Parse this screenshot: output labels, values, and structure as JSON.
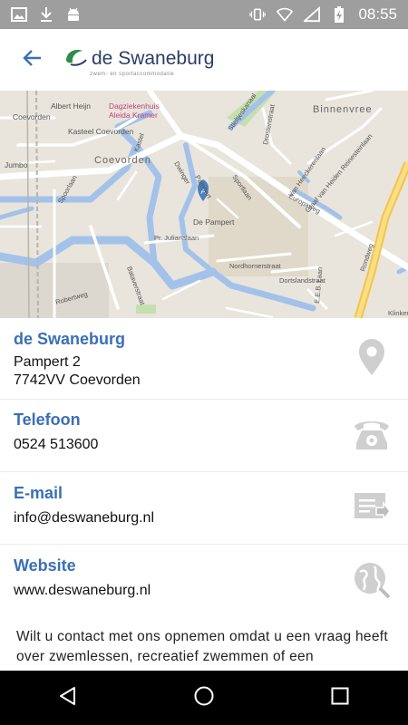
{
  "status_bar": {
    "time": "08:55",
    "icons": [
      "image-icon",
      "download-icon",
      "android-icon",
      "vibrate-icon",
      "wifi-icon",
      "signal-icon",
      "battery-charging-icon"
    ]
  },
  "header": {
    "logo_text": "de Swaneburg",
    "logo_subtitle": "zwem- en sportaccommodatie"
  },
  "map": {
    "labels": {
      "albert_heijn": "Albert Heijn",
      "dagziekenhuis": "Dagziekenhuis",
      "aleida": "Aleida Kramer",
      "coevorden_small": "Coevorden",
      "kasteel": "Kasteel Coevorden",
      "coevorden": "Coevorden",
      "binnenvree": "Binnenvree",
      "jumbo": "Jumbo",
      "de_pampert": "De Pampert",
      "pampert": "Pampert",
      "sportlaan": "Sportlaan",
      "europaweg": "Europaweg",
      "julianalaan": "Pr. Julianalaan",
      "bataverstraat": "Bataverstraat",
      "nordhornerstraat": "Nordhornerstraat",
      "dortslandstraat": "Dortslandstraat",
      "eeblaan": "E.E.B. Laan",
      "klinker": "Klinker",
      "rondweg": "Rondweg",
      "stieltjeskanaal": "Stieltjeskanaal",
      "drostenstraat": "Drostenstraat",
      "kastel": "Kastel",
      "dwinger": "Dwinger",
      "spoorlaan": "Spoorlaan",
      "robertweg": "Robertweg",
      "van_heeckerenlaan": "Van Heeckerenlaan",
      "graaf": "Graaf van Heiden Reinestein­laan",
      "pin_letter": "A"
    }
  },
  "contacts": [
    {
      "title": "de Swaneburg",
      "lines": [
        "Pampert 2",
        "7742VV  Coevorden"
      ],
      "icon": "location-pin-icon"
    },
    {
      "title": "Telefoon",
      "lines": [
        "0524 513600"
      ],
      "icon": "telephone-icon"
    },
    {
      "title": "E-mail",
      "lines": [
        "info@deswaneburg.nl"
      ],
      "icon": "email-icon"
    },
    {
      "title": "Website",
      "lines": [
        "www.deswaneburg.nl"
      ],
      "icon": "globe-icon"
    }
  ],
  "intro_text": "Wilt u contact met ons opnemen omdat u een vraag heeft over zwemlessen, recreatief zwemmen of een",
  "nav_bar": {
    "buttons": [
      "back-triangle-icon",
      "home-circle-icon",
      "recents-square-icon"
    ]
  },
  "colors": {
    "accent_title": "#3b6fb6",
    "status_bar": "#9e9e9e",
    "water": "#a3c2ea",
    "icon_gray": "#c8c8c8"
  }
}
